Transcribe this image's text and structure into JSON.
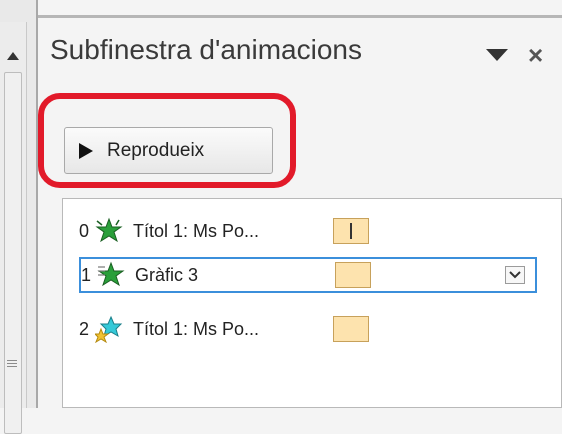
{
  "pane": {
    "title": "Subfinestra d'animacions",
    "play_button_label": "Reprodueix"
  },
  "animations": [
    {
      "index": "0",
      "label": "Títol 1: Ms Po...",
      "icon": "star-effect-icon"
    },
    {
      "index": "1",
      "label": "Gràfic 3",
      "icon": "star-effect-icon"
    },
    {
      "index": "2",
      "label": "Títol 1: Ms Po...",
      "icon": "star-effect-icon"
    }
  ],
  "colors": {
    "highlight_ring": "#e21a2a",
    "selection_border": "#3b8fdb",
    "timing_bar": "#fde3ae",
    "star_green": "#2a9f3a",
    "star_cyan": "#35c9d8"
  }
}
